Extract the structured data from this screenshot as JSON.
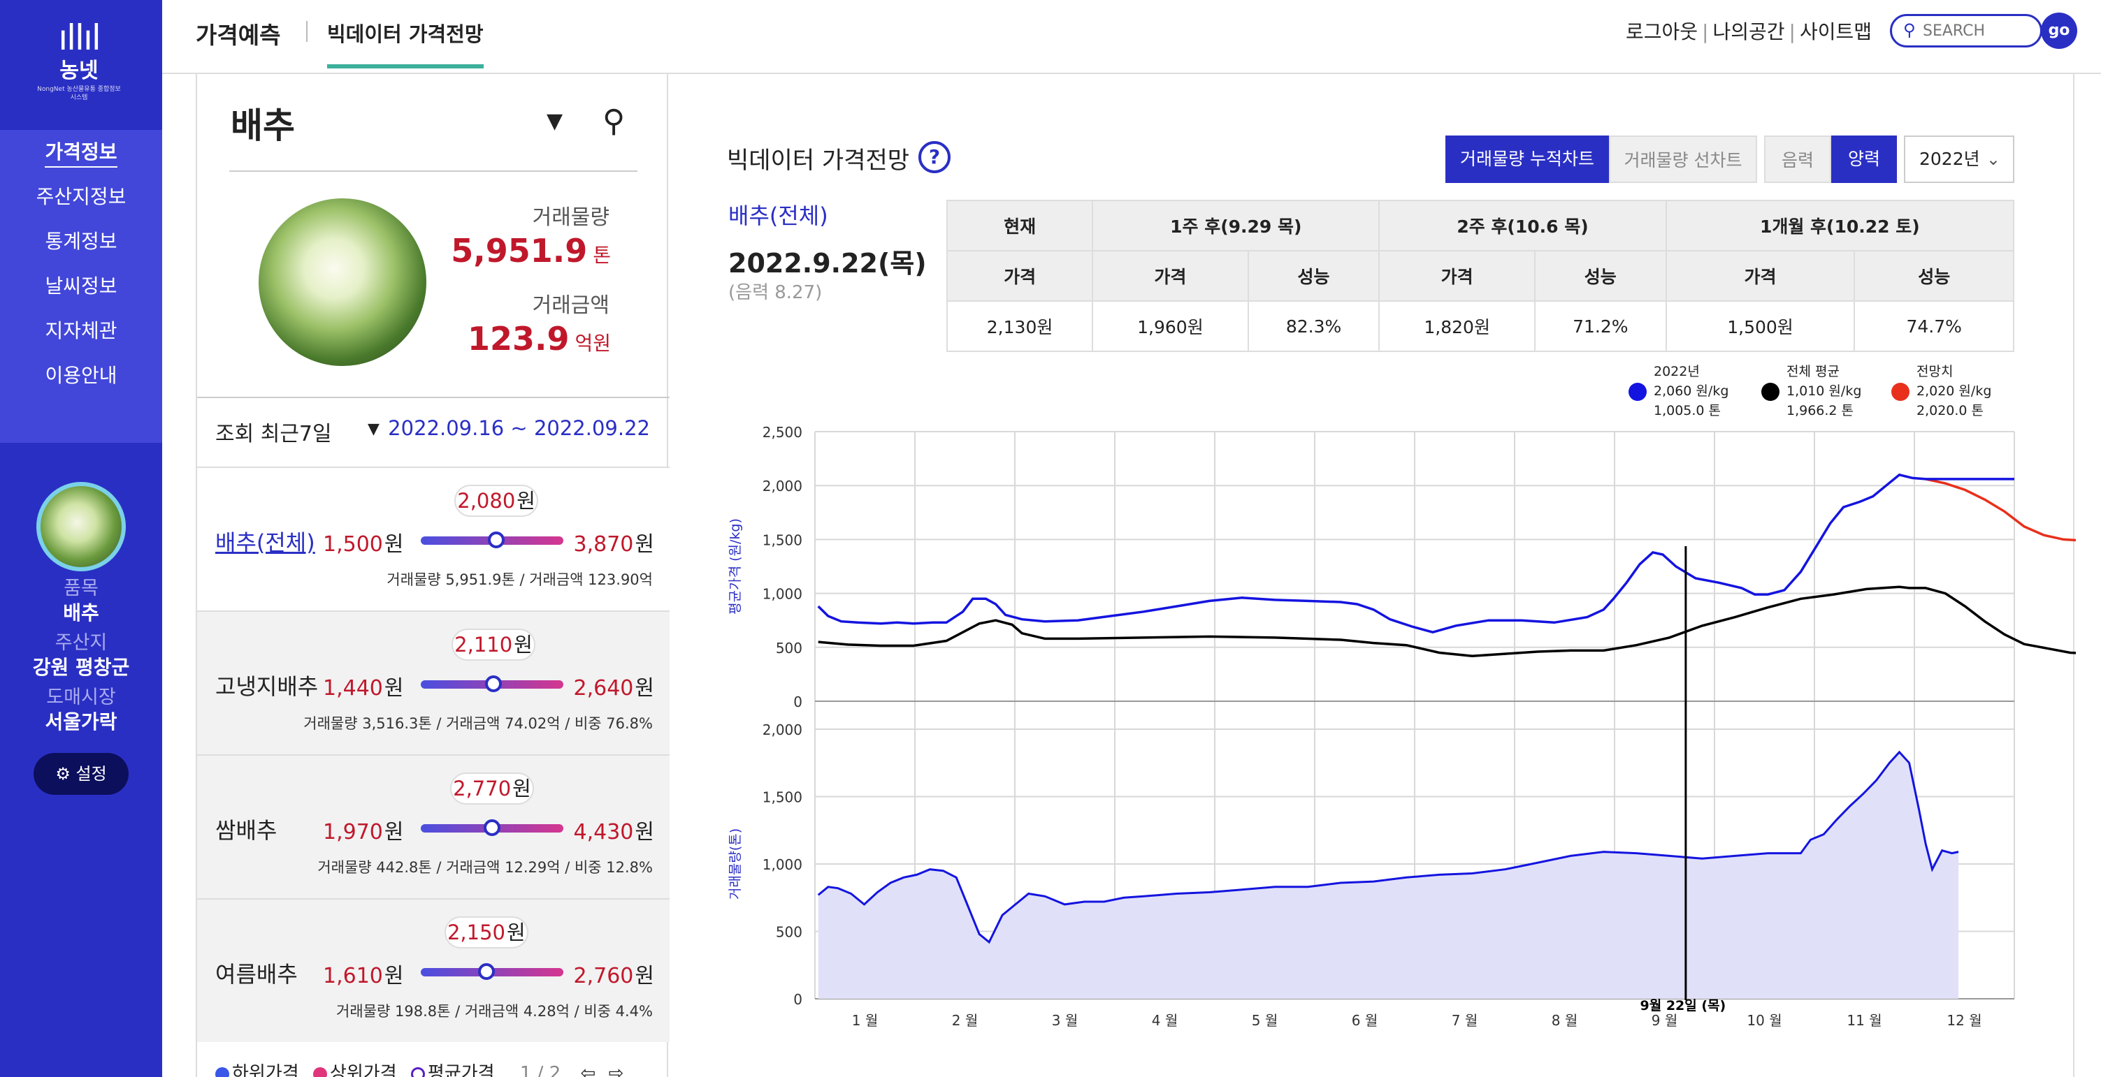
{
  "sidebar": {
    "logo": {
      "brand": "농넷",
      "sub": "NongNet 농산물유통 종합정보시스템"
    },
    "menu": [
      "가격정보",
      "주산지정보",
      "통계정보",
      "날씨정보",
      "지자체관",
      "이용안내"
    ],
    "profile": {
      "item_label": "품목",
      "item": "배추",
      "origin_label": "주산지",
      "origin": "강원 평창군",
      "market_label": "도매시장",
      "market": "서울가락"
    },
    "settings_label": "설정"
  },
  "topbar": {
    "title": "가격예측",
    "tab": "빅데이터 가격전망",
    "links": [
      "로그아웃",
      "나의공간",
      "사이트맵"
    ],
    "search_placeholder": "SEARCH",
    "go_label": "go"
  },
  "left": {
    "item": "배추",
    "volume_label": "거래물량",
    "volume": "5,951.9",
    "volume_unit": "톤",
    "amount_label": "거래금액",
    "amount": "123.9",
    "amount_unit": "억원",
    "period_label": "조회 최근7일",
    "period_range": "2022.09.16 ~ 2022.09.22",
    "rows": [
      {
        "name": "배추(전체)",
        "low": "1,500",
        "high": "3,870",
        "avg": "2,080",
        "avg_pos": 0.53,
        "detail": "거래물량 5,951.9톤 / 거래금액 123.90억"
      },
      {
        "name": "고냉지배추",
        "low": "1,440",
        "high": "2,640",
        "avg": "2,110",
        "avg_pos": 0.51,
        "detail": "거래물량 3,516.3톤 / 거래금액 74.02억 / 비중 76.8%"
      },
      {
        "name": "쌈배추",
        "low": "1,970",
        "high": "4,430",
        "avg": "2,770",
        "avg_pos": 0.5,
        "detail": "거래물량 442.8톤 / 거래금액 12.29억 / 비중 12.8%"
      },
      {
        "name": "여름배추",
        "low": "1,610",
        "high": "2,760",
        "avg": "2,150",
        "avg_pos": 0.46,
        "detail": "거래물량 198.8톤 / 거래금액 4.28억 / 비중 4.4%"
      }
    ],
    "won": "원",
    "legend": [
      "하위가격",
      "상위가격",
      "평균가격"
    ],
    "page": "1 / 2",
    "colors": {
      "low": "#3a57e8",
      "high": "#e0357a",
      "avg": "#5a1fc4"
    }
  },
  "main": {
    "title": "빅데이터 가격전망",
    "help": "?",
    "toggle_stack": "거래물량 누적차트",
    "toggle_line": "거래물량 선차트",
    "cal_lunar": "음력",
    "cal_solar": "양력",
    "year": "2022년",
    "item": "배추(전체)",
    "date": "2022.9.22(목)",
    "lunar": "(음력 8.27)",
    "table": {
      "groups": [
        "현재",
        "1주 후(9.29 목)",
        "2주 후(10.6 목)",
        "1개월 후(10.22 토)"
      ],
      "sub": [
        "가격",
        "가격",
        "성능",
        "가격",
        "성능",
        "가격",
        "성능"
      ],
      "values": [
        "2,130원",
        "1,960원",
        "82.3%",
        "1,820원",
        "71.2%",
        "1,500원",
        "74.7%"
      ]
    },
    "legend": [
      {
        "name": "2022년",
        "price": "2,060 원/kg",
        "volume": "1,005.0 톤",
        "color": "#1414e0"
      },
      {
        "name": "전체 평균",
        "price": "1,010 원/kg",
        "volume": "1,966.2 톤",
        "color": "#000000"
      },
      {
        "name": "전망치",
        "price": "2,020 원/kg",
        "volume": "2,020.0 톤",
        "color": "#e8301c"
      }
    ]
  },
  "chart_data": [
    {
      "type": "line",
      "ylabel": "평균가격 (원/kg)",
      "ylim": [
        0,
        2500
      ],
      "yticks": [
        0,
        500,
        1000,
        1500,
        2000,
        2500
      ],
      "months": [
        "1 월",
        "2 월",
        "3 월",
        "4 월",
        "5 월",
        "6 월",
        "7 월",
        "8 월",
        "9 월",
        "10 월",
        "11 월",
        "12 월"
      ],
      "marker_day": 265,
      "marker_label": "9월 22일 (목)",
      "series": [
        {
          "name": "2022년",
          "color": "#1414e0",
          "points": [
            [
              1,
              880
            ],
            [
              4,
              790
            ],
            [
              8,
              740
            ],
            [
              13,
              730
            ],
            [
              20,
              720
            ],
            [
              25,
              730
            ],
            [
              30,
              720
            ],
            [
              36,
              730
            ],
            [
              40,
              730
            ],
            [
              45,
              830
            ],
            [
              48,
              950
            ],
            [
              52,
              950
            ],
            [
              55,
              900
            ],
            [
              58,
              800
            ],
            [
              63,
              760
            ],
            [
              70,
              740
            ],
            [
              80,
              750
            ],
            [
              90,
              790
            ],
            [
              100,
              830
            ],
            [
              110,
              880
            ],
            [
              120,
              930
            ],
            [
              130,
              960
            ],
            [
              140,
              940
            ],
            [
              150,
              930
            ],
            [
              160,
              920
            ],
            [
              165,
              900
            ],
            [
              170,
              850
            ],
            [
              175,
              760
            ],
            [
              182,
              690
            ],
            [
              188,
              640
            ],
            [
              195,
              700
            ],
            [
              205,
              750
            ],
            [
              215,
              750
            ],
            [
              225,
              730
            ],
            [
              235,
              780
            ],
            [
              240,
              850
            ],
            [
              243,
              950
            ],
            [
              247,
              1100
            ],
            [
              251,
              1270
            ],
            [
              255,
              1380
            ],
            [
              258,
              1360
            ],
            [
              262,
              1250
            ],
            [
              268,
              1140
            ],
            [
              275,
              1100
            ],
            [
              282,
              1050
            ],
            [
              286,
              990
            ],
            [
              290,
              990
            ],
            [
              295,
              1030
            ],
            [
              300,
              1200
            ],
            [
              305,
              1450
            ],
            [
              309,
              1650
            ],
            [
              313,
              1800
            ],
            [
              318,
              1850
            ],
            [
              322,
              1900
            ],
            [
              326,
              2000
            ],
            [
              330,
              2100
            ],
            [
              334,
              2070
            ],
            [
              338,
              2060
            ]
          ]
        },
        {
          "name": "전체 평균",
          "color": "#000000",
          "points": [
            [
              1,
              550
            ],
            [
              10,
              525
            ],
            [
              20,
              515
            ],
            [
              30,
              515
            ],
            [
              40,
              560
            ],
            [
              45,
              640
            ],
            [
              50,
              720
            ],
            [
              55,
              750
            ],
            [
              60,
              710
            ],
            [
              63,
              630
            ],
            [
              70,
              580
            ],
            [
              80,
              580
            ],
            [
              100,
              590
            ],
            [
              120,
              600
            ],
            [
              140,
              590
            ],
            [
              160,
              570
            ],
            [
              170,
              540
            ],
            [
              180,
              520
            ],
            [
              190,
              450
            ],
            [
              200,
              420
            ],
            [
              210,
              440
            ],
            [
              220,
              460
            ],
            [
              230,
              470
            ],
            [
              240,
              470
            ],
            [
              250,
              520
            ],
            [
              260,
              590
            ],
            [
              270,
              700
            ],
            [
              280,
              780
            ],
            [
              290,
              870
            ],
            [
              300,
              950
            ],
            [
              310,
              990
            ],
            [
              320,
              1040
            ],
            [
              330,
              1060
            ],
            [
              333,
              1050
            ],
            [
              338,
              1050
            ],
            [
              344,
              1000
            ],
            [
              350,
              880
            ],
            [
              356,
              740
            ],
            [
              362,
              620
            ],
            [
              368,
              530
            ],
            [
              375,
              490
            ],
            [
              382,
              450
            ],
            [
              390,
              440
            ],
            [
              400,
              450
            ],
            [
              410,
              470
            ],
            [
              420,
              490
            ],
            [
              430,
              490
            ],
            [
              440,
              485
            ],
            [
              450,
              480
            ],
            [
              460,
              470
            ],
            [
              470,
              480
            ],
            [
              482,
              495
            ]
          ]
        },
        {
          "name": "전망치",
          "color": "#e8301c",
          "points": [
            [
              338,
              2060
            ],
            [
              344,
              2020
            ],
            [
              350,
              1960
            ],
            [
              356,
              1870
            ],
            [
              362,
              1760
            ],
            [
              368,
              1620
            ],
            [
              374,
              1540
            ],
            [
              380,
              1500
            ],
            [
              386,
              1490
            ]
          ]
        }
      ]
    },
    {
      "type": "area",
      "ylabel": "거래물량(톤)",
      "ylim": [
        0,
        2000
      ],
      "yticks": [
        0,
        500,
        1000,
        1500,
        2000
      ],
      "series": [
        {
          "name": "2022년",
          "color": "#1414e0",
          "fill": "#e0e1f8",
          "points": [
            [
              1,
              770
            ],
            [
              4,
              830
            ],
            [
              7,
              820
            ],
            [
              11,
              780
            ],
            [
              15,
              700
            ],
            [
              19,
              790
            ],
            [
              23,
              860
            ],
            [
              27,
              900
            ],
            [
              31,
              920
            ],
            [
              35,
              960
            ],
            [
              39,
              950
            ],
            [
              43,
              900
            ],
            [
              46,
              720
            ],
            [
              50,
              480
            ],
            [
              53,
              420
            ],
            [
              57,
              620
            ],
            [
              61,
              700
            ],
            [
              65,
              780
            ],
            [
              70,
              760
            ],
            [
              76,
              700
            ],
            [
              82,
              720
            ],
            [
              88,
              720
            ],
            [
              94,
              750
            ],
            [
              100,
              760
            ],
            [
              110,
              780
            ],
            [
              120,
              790
            ],
            [
              130,
              810
            ],
            [
              140,
              830
            ],
            [
              150,
              830
            ],
            [
              160,
              860
            ],
            [
              170,
              870
            ],
            [
              180,
              900
            ],
            [
              190,
              920
            ],
            [
              200,
              930
            ],
            [
              210,
              960
            ],
            [
              220,
              1010
            ],
            [
              230,
              1060
            ],
            [
              240,
              1090
            ],
            [
              250,
              1080
            ],
            [
              260,
              1060
            ],
            [
              270,
              1040
            ],
            [
              280,
              1060
            ],
            [
              290,
              1080
            ],
            [
              300,
              1080
            ],
            [
              303,
              1180
            ],
            [
              307,
              1220
            ],
            [
              311,
              1330
            ],
            [
              315,
              1430
            ],
            [
              319,
              1520
            ],
            [
              323,
              1620
            ],
            [
              327,
              1750
            ],
            [
              330,
              1830
            ],
            [
              333,
              1750
            ],
            [
              336,
              1400
            ],
            [
              338,
              1150
            ],
            [
              340,
              960
            ],
            [
              343,
              1100
            ],
            [
              346,
              1080
            ],
            [
              348,
              1090
            ]
          ]
        }
      ]
    }
  ]
}
